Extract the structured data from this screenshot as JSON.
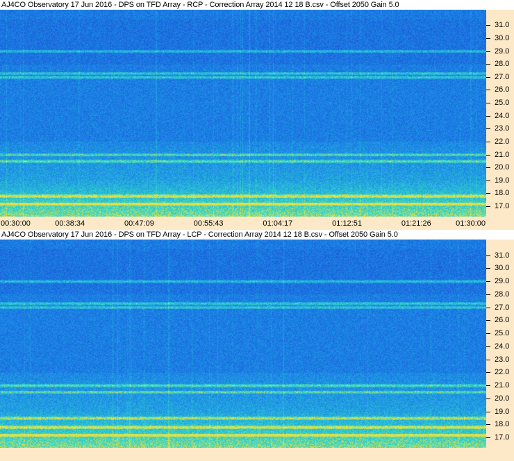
{
  "chart_data": [
    {
      "type": "heatmap",
      "title": "AJ4CO Observatory 17 Jun 2016  -  DPS on TFD Array  -  RCP  -  Correction Array 2014 12 18 B.csv  -  Offset 2050  Gain 5.0",
      "polarization": "RCP",
      "ylim": [
        16.2,
        32.2
      ],
      "yticks": [
        "31.0",
        "30.0",
        "29.0",
        "28.0",
        "27.0",
        "26.0",
        "25.0",
        "24.0",
        "23.0",
        "22.0",
        "21.0",
        "20.0",
        "19.0",
        "18.0",
        "17.0"
      ],
      "xticks": [
        "00:30:00",
        "00:38:34",
        "00:47:09",
        "00:55:43",
        "01:04:17",
        "01:12:51",
        "01:21:26",
        "01:30:00"
      ],
      "bright_bands_mhz": [
        17.2,
        17.8,
        20.5,
        21.0,
        27.0,
        27.3,
        29.0
      ],
      "colors": {
        "low": "#1a3fd0",
        "mid": "#1c8ee8",
        "high": "#34d8c8",
        "peak": "#e8e040"
      }
    },
    {
      "type": "heatmap",
      "title": "AJ4CO Observatory 17 Jun 2016  -  DPS on TFD Array  -  LCP  -  Correction Array 2014 12 18 B.csv  -  Offset 2050  Gain 5.0",
      "polarization": "LCP",
      "ylim": [
        16.2,
        32.2
      ],
      "yticks": [
        "31.0",
        "30.0",
        "29.0",
        "28.0",
        "27.0",
        "26.0",
        "25.0",
        "24.0",
        "23.0",
        "22.0",
        "21.0",
        "20.0",
        "19.0",
        "18.0",
        "17.0"
      ],
      "xticks": [],
      "bright_bands_mhz": [
        17.2,
        17.8,
        18.5,
        20.5,
        21.0,
        27.0,
        27.3,
        29.0
      ],
      "colors": {
        "low": "#1a3fd0",
        "mid": "#1c8ee8",
        "high": "#34d8c8",
        "peak": "#e8e040"
      }
    }
  ]
}
